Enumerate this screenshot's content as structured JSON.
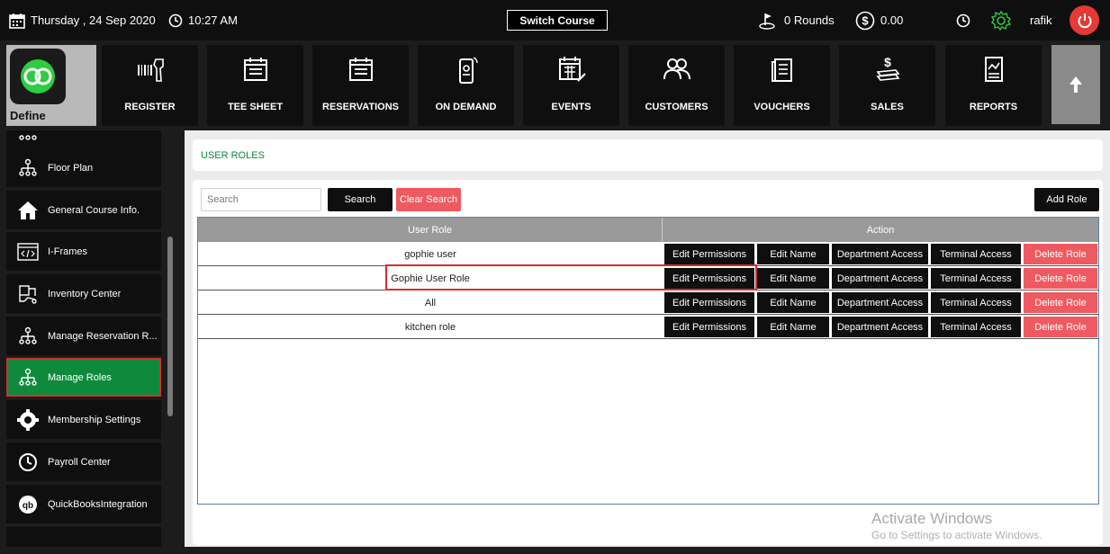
{
  "topbar": {
    "date": "Thursday , 24 Sep 2020",
    "time": "10:27 AM",
    "switch_course": "Switch Course",
    "rounds": "0 Rounds",
    "balance": "0.00",
    "user": "rafik"
  },
  "logo": {
    "label": "Define"
  },
  "nav": [
    {
      "label": "REGISTER",
      "icon": "barcode-scanner-icon"
    },
    {
      "label": "TEE SHEET",
      "icon": "calendar-icon"
    },
    {
      "label": "RESERVATIONS",
      "icon": "calendar-list-icon"
    },
    {
      "label": "ON DEMAND",
      "icon": "mobile-phone-icon"
    },
    {
      "label": "EVENTS",
      "icon": "event-calendar-icon"
    },
    {
      "label": "CUSTOMERS",
      "icon": "people-icon"
    },
    {
      "label": "VOUCHERS",
      "icon": "voucher-icon"
    },
    {
      "label": "SALES",
      "icon": "money-icon"
    },
    {
      "label": "REPORTS",
      "icon": "report-icon"
    }
  ],
  "sidebar": {
    "items": [
      {
        "label": "Floor Plan",
        "icon": "hierarchy-icon"
      },
      {
        "label": "General Course Info.",
        "icon": "home-icon"
      },
      {
        "label": "I-Frames",
        "icon": "code-icon"
      },
      {
        "label": "Inventory Center",
        "icon": "inventory-icon"
      },
      {
        "label": "Manage Reservation R...",
        "icon": "hierarchy-icon"
      },
      {
        "label": "Manage Roles",
        "icon": "hierarchy-icon"
      },
      {
        "label": "Membership Settings",
        "icon": "gear-icon"
      },
      {
        "label": "Payroll Center",
        "icon": "clock-icon"
      },
      {
        "label": "QuickBooksIntegration",
        "icon": "quickbooks-icon"
      }
    ]
  },
  "page": {
    "title": "USER ROLES"
  },
  "search": {
    "placeholder": "Search",
    "button": "Search",
    "clear": "Clear Search",
    "add": "Add Role"
  },
  "grid": {
    "headers": {
      "role": "User Role",
      "action": "Action"
    },
    "actions": {
      "edit_permissions": "Edit Permissions",
      "edit_name": "Edit Name",
      "department": "Department Access",
      "terminal": "Terminal Access",
      "delete": "Delete Role"
    },
    "rows": [
      {
        "name": "gophie user"
      },
      {
        "name": "Gophie User Role"
      },
      {
        "name": "All"
      },
      {
        "name": "kitchen role"
      }
    ]
  },
  "watermark": {
    "line1": "Activate Windows",
    "line2": "Go to Settings to activate Windows."
  },
  "colors": {
    "accent_green": "#0f8a3c",
    "danger_red": "#ef5a61",
    "dark": "#0f0f0f",
    "highlight": "#d32f2f"
  }
}
